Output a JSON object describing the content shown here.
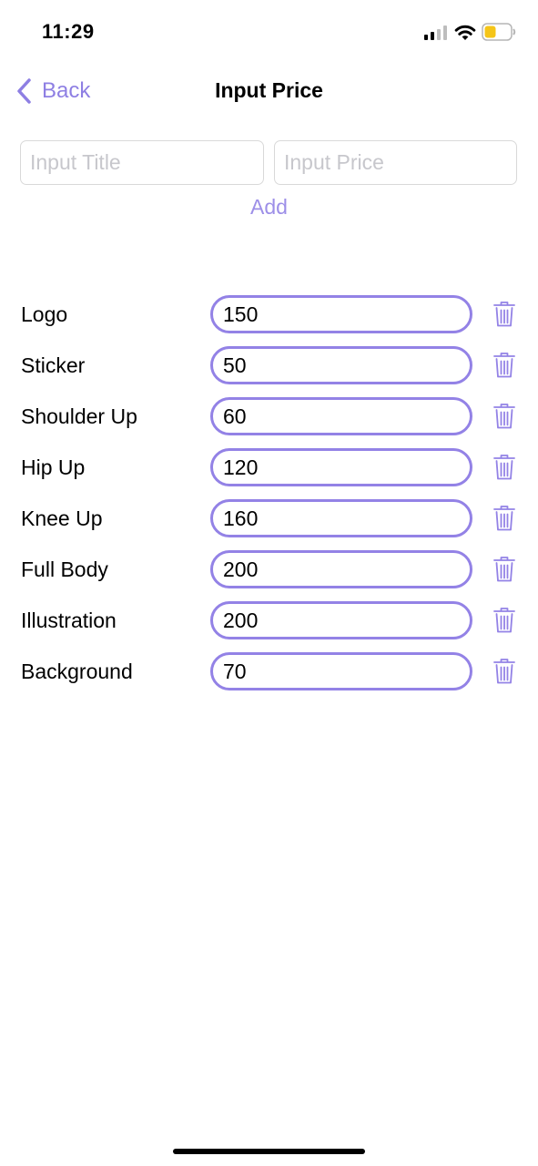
{
  "status_bar": {
    "time": "11:29",
    "icons": [
      "cellular-signal-icon",
      "wifi-icon",
      "battery-icon"
    ],
    "battery_color": "#f5c518"
  },
  "nav": {
    "back_label": "Back",
    "title": "Input Price"
  },
  "form": {
    "title_placeholder": "Input Title",
    "price_placeholder": "Input Price",
    "title_value": "",
    "price_value": "",
    "add_label": "Add"
  },
  "items": [
    {
      "title": "Logo",
      "price": "150"
    },
    {
      "title": "Sticker",
      "price": "50"
    },
    {
      "title": "Shoulder Up",
      "price": "60"
    },
    {
      "title": "Hip Up",
      "price": "120"
    },
    {
      "title": "Knee Up",
      "price": "160"
    },
    {
      "title": "Full Body",
      "price": "200"
    },
    {
      "title": "Illustration",
      "price": "200"
    },
    {
      "title": "Background",
      "price": "70"
    }
  ],
  "colors": {
    "accent": "#8e7fe3",
    "field_border": "#9382e6",
    "placeholder": "#c7c7cc"
  }
}
